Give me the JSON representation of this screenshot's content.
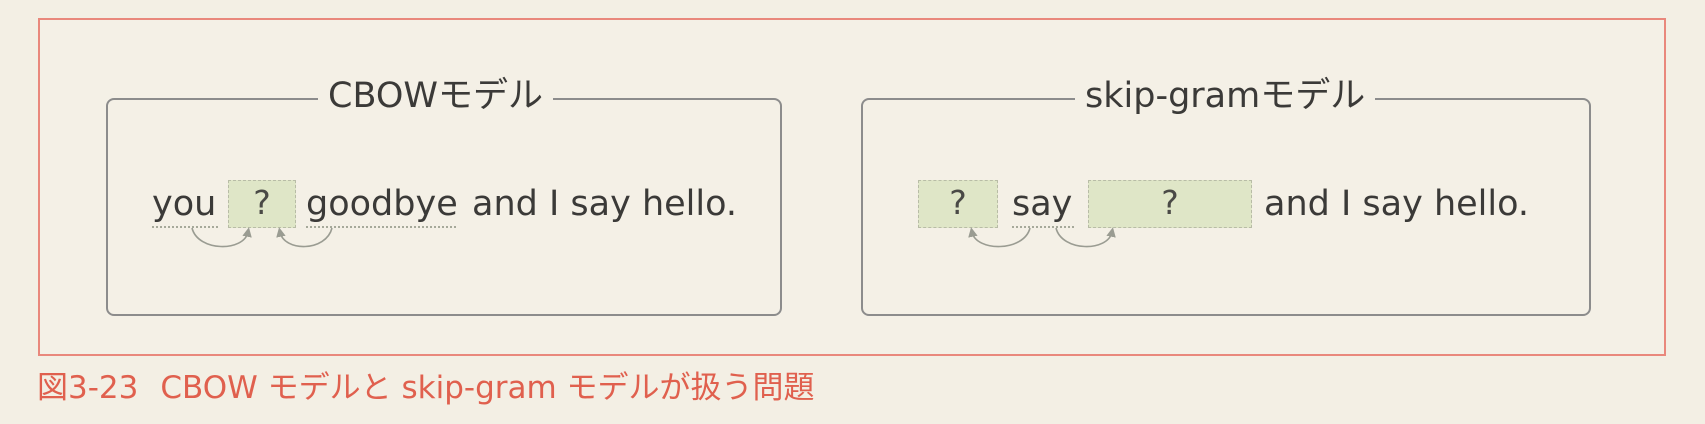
{
  "cbow": {
    "title": "CBOWモデル",
    "words": {
      "you": "you",
      "target": "?",
      "goodbye": "goodbye",
      "rest": "and I say hello."
    }
  },
  "skipgram": {
    "title": "skip-gramモデル",
    "words": {
      "left_target": "?",
      "say": "say",
      "right_target": "?",
      "rest": "and I say hello."
    }
  },
  "caption": {
    "number": "図3-23",
    "text": "CBOW モデルと skip-gram モデルが扱う問題"
  },
  "colors": {
    "frame": "#e9887c",
    "caption": "#e0604e",
    "highlight": "#dfe6c7",
    "panel_border": "#8c8c8c"
  }
}
